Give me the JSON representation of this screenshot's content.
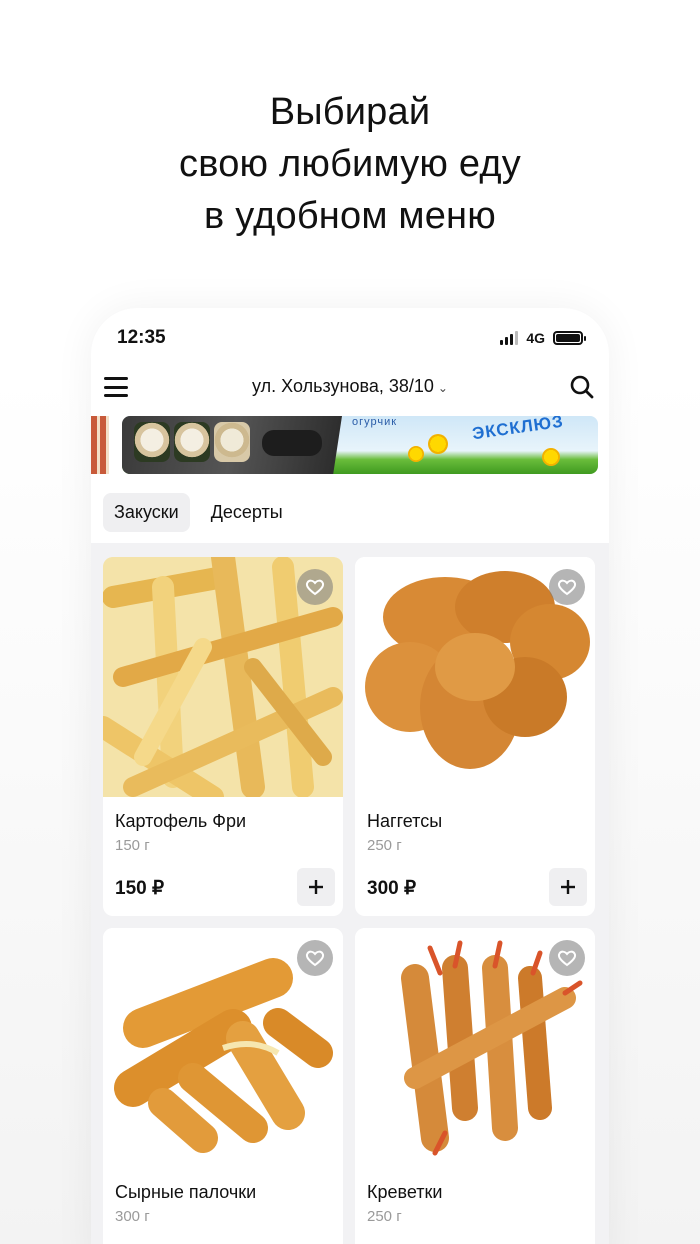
{
  "headline": [
    "Выбирай",
    "свою любимую еду",
    "в удобном меню"
  ],
  "status": {
    "time": "12:35",
    "network": "4G"
  },
  "header": {
    "address": "ул. Хользунова, 38/10"
  },
  "banner": {
    "text_small": "огурчик",
    "text_big": "ЭКСКЛЮЗ"
  },
  "tabs": [
    {
      "label": "Закуски",
      "active": true
    },
    {
      "label": "Десерты",
      "active": false
    }
  ],
  "products": [
    {
      "name": "Картофель Фри",
      "weight": "150 г",
      "price": "150 ₽"
    },
    {
      "name": "Наггетсы",
      "weight": "250 г",
      "price": "300 ₽"
    },
    {
      "name": "Сырные палочки",
      "weight": "300 г",
      "price": ""
    },
    {
      "name": "Креветки",
      "weight": "250 г",
      "price": ""
    }
  ],
  "colors": {
    "accent": "#111111",
    "muted": "#9a9a9a",
    "chip": "#efeff1",
    "card_bg": "#ffffff",
    "screen_bg": "#f2f2f4"
  },
  "icons": {
    "menu": "hamburger-icon",
    "search": "search-icon",
    "favorite": "heart-icon",
    "add": "plus-icon",
    "dropdown": "chevron-down-icon"
  }
}
